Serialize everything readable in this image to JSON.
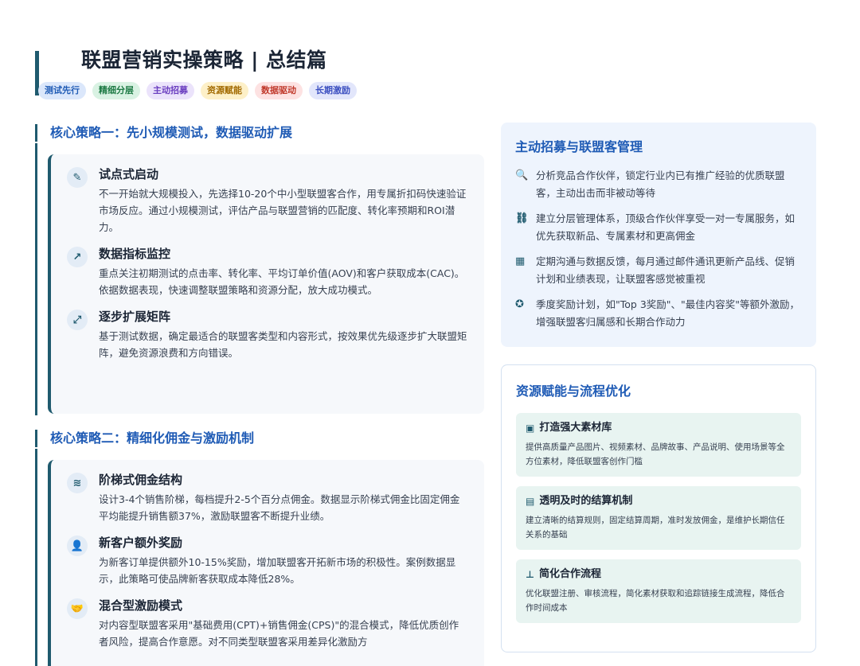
{
  "header": {
    "title": "联盟营销实操策略 | 总结篇",
    "tags": [
      {
        "label": "测试先行",
        "bg": "#dbe7fb",
        "color": "#1f5bb5"
      },
      {
        "label": "精细分层",
        "bg": "#d9f2e3",
        "color": "#1d7a44"
      },
      {
        "label": "主动招募",
        "bg": "#ebe3fb",
        "color": "#6b3fc0"
      },
      {
        "label": "资源赋能",
        "bg": "#fdf0c8",
        "color": "#a26a00"
      },
      {
        "label": "数据驱动",
        "bg": "#fde2e2",
        "color": "#c0392b"
      },
      {
        "label": "长期激励",
        "bg": "#e2e6fb",
        "color": "#3b4fc0"
      }
    ]
  },
  "strategy1": {
    "title": "核心策略一：先小规模测试，数据驱动扩展",
    "items": [
      {
        "icon": "pen-icon",
        "glyph": "✎",
        "title": "试点式启动",
        "desc": "不一开始就大规模投入，先选择10-20个中小型联盟客合作，用专属折扣码快速验证市场反应。通过小规模测试，评估产品与联盟营销的匹配度、转化率预期和ROI潜力。"
      },
      {
        "icon": "line-chart-icon",
        "glyph": "↗",
        "title": "数据指标监控",
        "desc": "重点关注初期测试的点击率、转化率、平均订单价值(AOV)和客户获取成本(CAC)。依据数据表现，快速调整联盟策略和资源分配，放大成功模式。"
      },
      {
        "icon": "expand-icon",
        "glyph": "⤢",
        "title": "逐步扩展矩阵",
        "desc": "基于测试数据，确定最适合的联盟客类型和内容形式，按效果优先级逐步扩大联盟矩阵，避免资源浪费和方向错误。"
      }
    ]
  },
  "strategy2": {
    "title": "核心策略二：精细化佣金与激励机制",
    "items": [
      {
        "icon": "layers-icon",
        "glyph": "≋",
        "title": "阶梯式佣金结构",
        "desc": "设计3-4个销售阶梯，每档提升2-5个百分点佣金。数据显示阶梯式佣金比固定佣金平均能提升销售额37%，激励联盟客不断提升业绩。"
      },
      {
        "icon": "user-plus-icon",
        "glyph": "👤",
        "title": "新客户额外奖励",
        "desc": "为新客订单提供额外10-15%奖励，增加联盟客开拓新市场的积极性。案例数据显示，此策略可使品牌新客获取成本降低28%。"
      },
      {
        "icon": "handshake-icon",
        "glyph": "🤝",
        "title": "混合型激励模式",
        "desc": "对内容型联盟客采用\"基础费用(CPT)+销售佣金(CPS)\"的混合模式，降低优质创作者风险，提高合作意愿。对不同类型联盟客采用差异化激励方"
      }
    ]
  },
  "recruit": {
    "title": "主动招募与联盟客管理",
    "bullets": [
      {
        "icon": "search-icon",
        "glyph": "🔍",
        "text": "分析竞品合作伙伴，锁定行业内已有推广经验的优质联盟客，主动出击而非被动等待"
      },
      {
        "icon": "hierarchy-icon",
        "glyph": "⛓",
        "text": "建立分层管理体系，顶级合作伙伴享受一对一专属服务，如优先获取新品、专属素材和更高佣金"
      },
      {
        "icon": "calendar-icon",
        "glyph": "▦",
        "text": "定期沟通与数据反馈，每月通过邮件通讯更新产品线、促销计划和业绩表现，让联盟客感觉被重视"
      },
      {
        "icon": "award-icon",
        "glyph": "✪",
        "text": "季度奖励计划，如\"Top 3奖励\"、\"最佳内容奖\"等额外激励，增强联盟客归属感和长期合作动力"
      }
    ]
  },
  "resource": {
    "title": "资源赋能与流程优化",
    "cards": [
      {
        "icon": "image-icon",
        "glyph": "▣",
        "title": "打造强大素材库",
        "desc": "提供高质量产品图片、视频素材、品牌故事、产品说明、使用场景等全方位素材，降低联盟客创作门槛"
      },
      {
        "icon": "money-icon",
        "glyph": "▤",
        "title": "透明及时的结算机制",
        "desc": "建立清晰的结算规则，固定结算周期，准时发放佣金，是维护长期信任关系的基础"
      },
      {
        "icon": "sitemap-icon",
        "glyph": "⊥",
        "title": "简化合作流程",
        "desc": "优化联盟注册、审核流程，简化素材获取和追踪链接生成流程，降低合作时间成本"
      }
    ]
  }
}
